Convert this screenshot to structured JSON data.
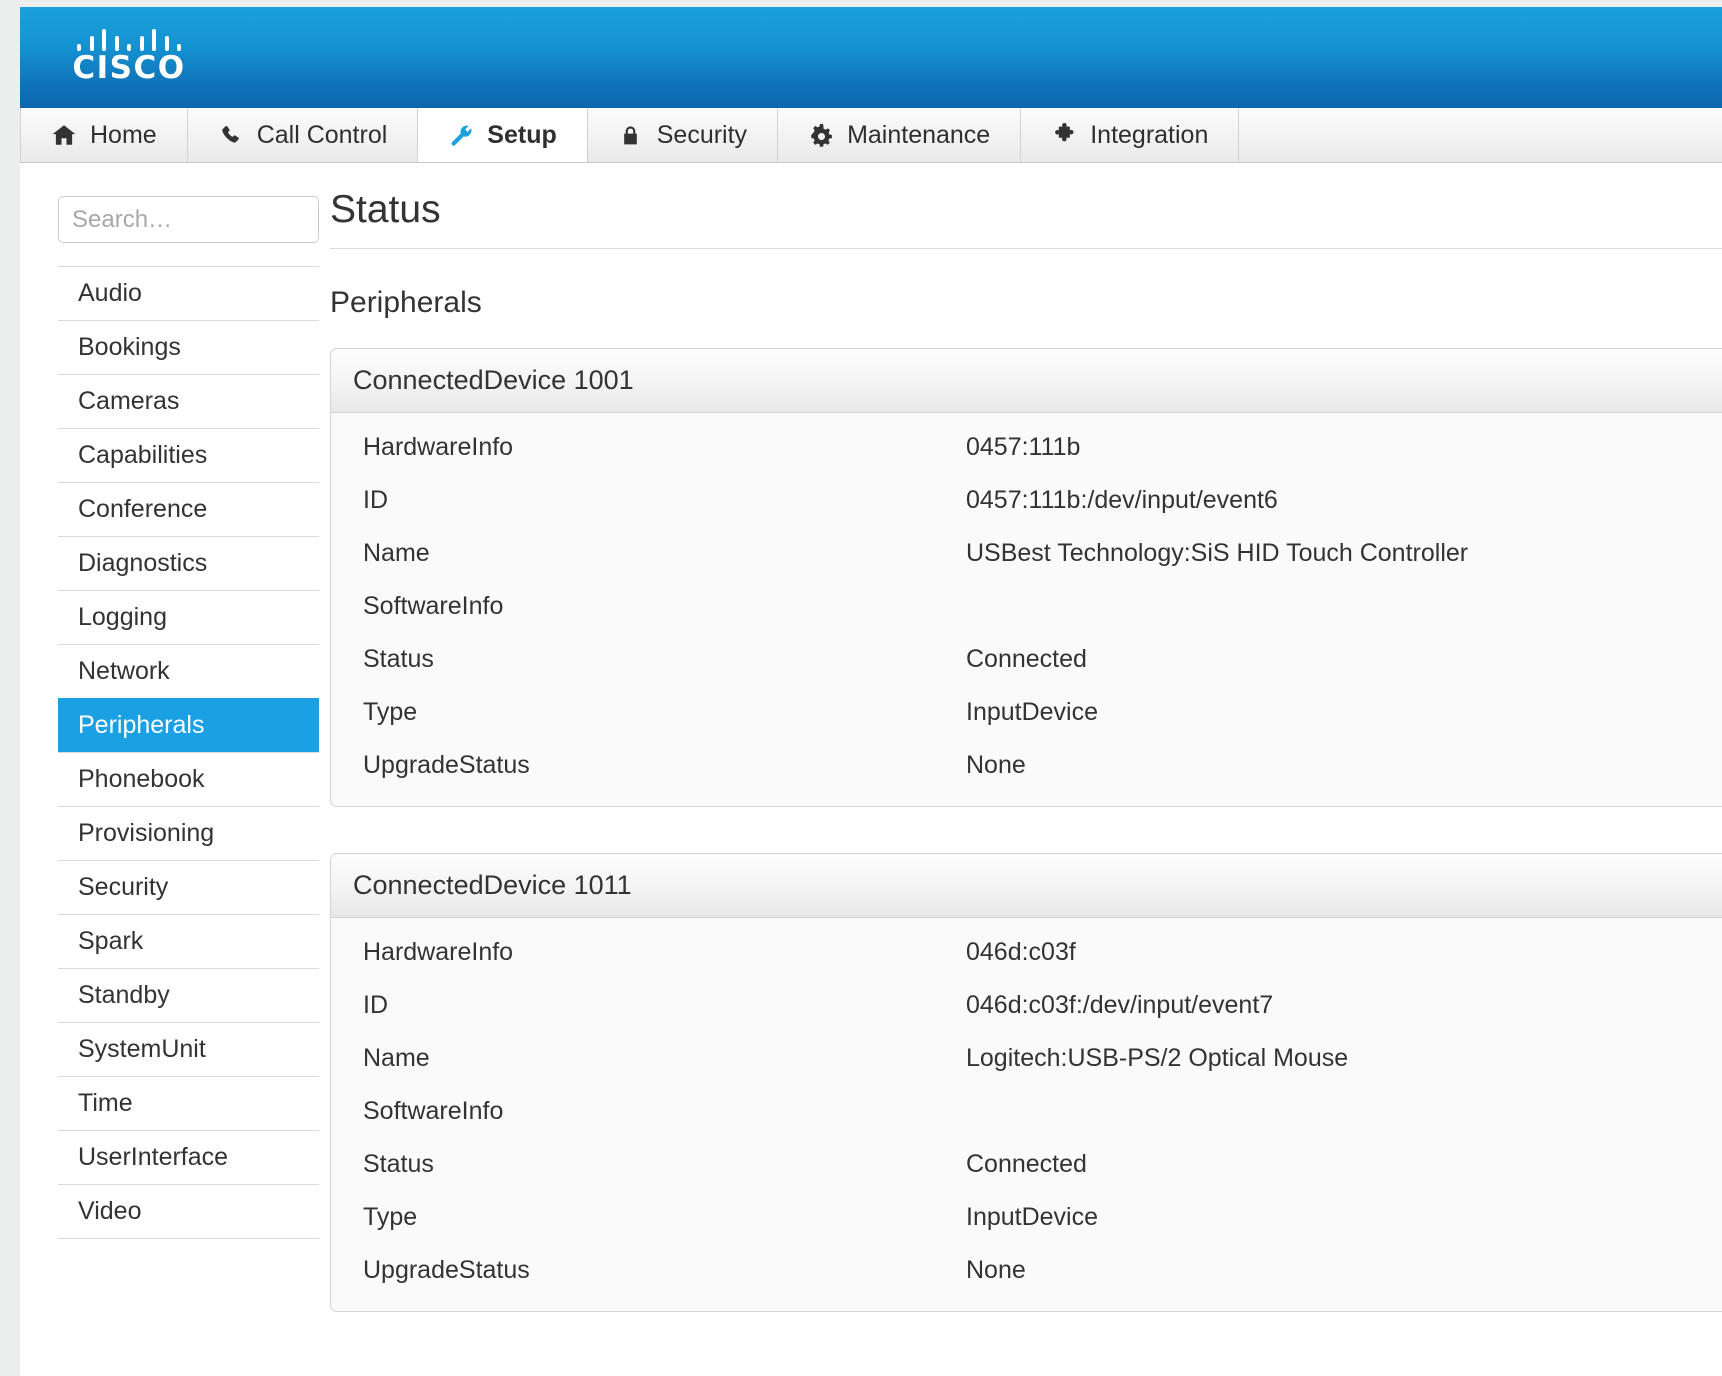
{
  "brand": {
    "name": "CISCO",
    "logo_icon": "cisco-logo-icon"
  },
  "nav": {
    "tabs": [
      {
        "label": "Home",
        "icon": "home-icon",
        "active": false
      },
      {
        "label": "Call Control",
        "icon": "phone-icon",
        "active": false
      },
      {
        "label": "Setup",
        "icon": "wrench-icon",
        "active": true
      },
      {
        "label": "Security",
        "icon": "lock-icon",
        "active": false
      },
      {
        "label": "Maintenance",
        "icon": "gear-icon",
        "active": false
      },
      {
        "label": "Integration",
        "icon": "puzzle-piece-icon",
        "active": false
      }
    ]
  },
  "sidebar": {
    "search": {
      "placeholder": "Search…",
      "value": ""
    },
    "items": [
      {
        "label": "Audio",
        "selected": false
      },
      {
        "label": "Bookings",
        "selected": false
      },
      {
        "label": "Cameras",
        "selected": false
      },
      {
        "label": "Capabilities",
        "selected": false
      },
      {
        "label": "Conference",
        "selected": false
      },
      {
        "label": "Diagnostics",
        "selected": false
      },
      {
        "label": "Logging",
        "selected": false
      },
      {
        "label": "Network",
        "selected": false
      },
      {
        "label": "Peripherals",
        "selected": true
      },
      {
        "label": "Phonebook",
        "selected": false
      },
      {
        "label": "Provisioning",
        "selected": false
      },
      {
        "label": "Security",
        "selected": false
      },
      {
        "label": "Spark",
        "selected": false
      },
      {
        "label": "Standby",
        "selected": false
      },
      {
        "label": "SystemUnit",
        "selected": false
      },
      {
        "label": "Time",
        "selected": false
      },
      {
        "label": "UserInterface",
        "selected": false
      },
      {
        "label": "Video",
        "selected": false
      }
    ]
  },
  "main": {
    "page_title": "Status",
    "section_title": "Peripherals",
    "panels": [
      {
        "title": "ConnectedDevice 1001",
        "rows": [
          {
            "label": "HardwareInfo",
            "value": "0457:111b"
          },
          {
            "label": "ID",
            "value": "0457:111b:/dev/input/event6"
          },
          {
            "label": "Name",
            "value": "USBest Technology:SiS HID Touch Controller"
          },
          {
            "label": "SoftwareInfo",
            "value": ""
          },
          {
            "label": "Status",
            "value": "Connected"
          },
          {
            "label": "Type",
            "value": "InputDevice"
          },
          {
            "label": "UpgradeStatus",
            "value": "None"
          }
        ]
      },
      {
        "title": "ConnectedDevice 1011",
        "rows": [
          {
            "label": "HardwareInfo",
            "value": "046d:c03f"
          },
          {
            "label": "ID",
            "value": "046d:c03f:/dev/input/event7"
          },
          {
            "label": "Name",
            "value": "Logitech:USB-PS/2 Optical Mouse"
          },
          {
            "label": "SoftwareInfo",
            "value": ""
          },
          {
            "label": "Status",
            "value": "Connected"
          },
          {
            "label": "Type",
            "value": "InputDevice"
          },
          {
            "label": "UpgradeStatus",
            "value": "None"
          }
        ]
      }
    ]
  },
  "colors": {
    "brand_blue": "#0f72b8",
    "accent_blue": "#1ba0e3",
    "panel_bg": "#fafafa",
    "page_bg": "#eceded"
  }
}
